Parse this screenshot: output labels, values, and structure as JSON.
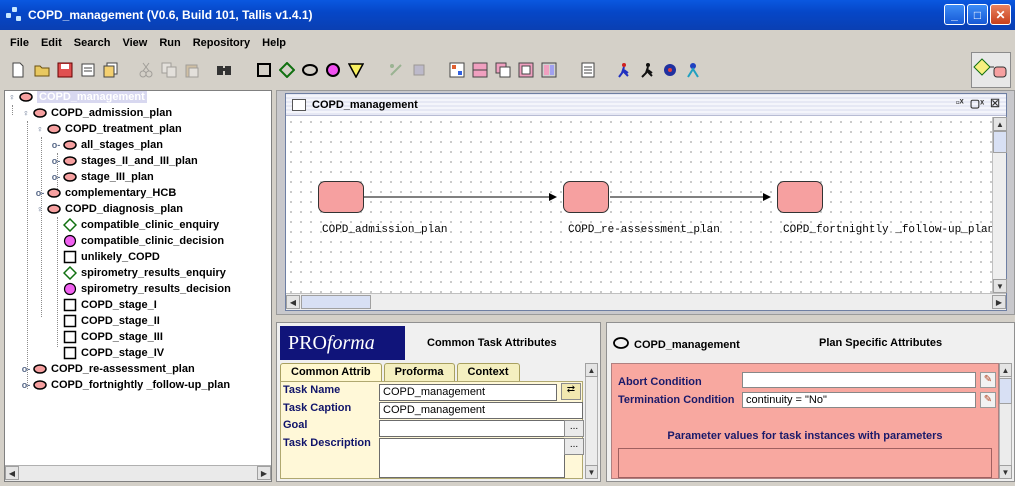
{
  "window": {
    "title": "COPD_management (V0.6, Build 101, Tallis v1.4.1)"
  },
  "menu": [
    "File",
    "Edit",
    "Search",
    "View",
    "Run",
    "Repository",
    "Help"
  ],
  "toolbar": {
    "icons": [
      "new-file-icon",
      "open-folder-icon",
      "save-icon",
      "properties-icon",
      "copy-doc-icon",
      "cut-icon",
      "copy-icon",
      "paste-icon",
      "find-icon",
      "plan-square-icon",
      "enquiry-diamond-icon",
      "plan-ellipse-icon",
      "decision-circle-icon",
      "action-triangle-icon",
      "link-icon",
      "unlink-icon",
      "grid-icon",
      "tile-icon",
      "cascade-icon",
      "window-icon",
      "windows-icon",
      "document-icon",
      "run-icon",
      "run-step-icon",
      "debug-icon",
      "stop-icon"
    ]
  },
  "tree": {
    "root": "COPD_management",
    "items": [
      {
        "label": "COPD_admission_plan",
        "type": "plan"
      },
      {
        "label": "COPD_treatment_plan",
        "type": "plan"
      },
      {
        "label": "all_stages_plan",
        "type": "plan"
      },
      {
        "label": "stages_II_and_III_plan",
        "type": "plan"
      },
      {
        "label": "stage_III_plan",
        "type": "plan"
      },
      {
        "label": "complementary_HCB",
        "type": "plan"
      },
      {
        "label": "COPD_diagnosis_plan",
        "type": "plan"
      },
      {
        "label": "compatible_clinic_enquiry",
        "type": "enquiry"
      },
      {
        "label": "compatible_clinic_decision",
        "type": "decision"
      },
      {
        "label": "unlikely_COPD",
        "type": "action"
      },
      {
        "label": "spirometry_results_enquiry",
        "type": "enquiry"
      },
      {
        "label": "spirometry_results_decision",
        "type": "decision"
      },
      {
        "label": "COPD_stage_I",
        "type": "action"
      },
      {
        "label": "COPD_stage_II",
        "type": "action"
      },
      {
        "label": "COPD_stage_III",
        "type": "action"
      },
      {
        "label": "COPD_stage_IV",
        "type": "action"
      },
      {
        "label": "COPD_re-assessment_plan",
        "type": "plan"
      },
      {
        "label": "COPD_fortnightly _follow-up_plan",
        "type": "plan"
      }
    ]
  },
  "canvas": {
    "title": "COPD_management",
    "nodes": [
      {
        "label": "COPD_admission_plan"
      },
      {
        "label": "COPD_re-assessment_plan"
      },
      {
        "label": "COPD_fortnightly _follow-up_plan"
      }
    ],
    "colors": {
      "node_fill": "#f6a0a0"
    }
  },
  "props": {
    "logo_pro": "PRO",
    "logo_forma": "forma",
    "heading": "Common Task Attributes",
    "tabs": [
      "Common Attrib",
      "Proforma",
      "Context"
    ],
    "task_name_label": "Task Name",
    "task_name_value": "COPD_management",
    "task_caption_label": "Task Caption",
    "task_caption_value": "COPD_management",
    "goal_label": "Goal",
    "task_description_label": "Task Description",
    "dots": "..."
  },
  "plan_attrs": {
    "name": "COPD_management",
    "heading": "Plan Specific Attributes",
    "abort_label": "Abort Condition",
    "abort_value": "",
    "termination_label": "Termination Condition",
    "termination_value": "continuity = \"No\"",
    "param_heading": "Parameter values for task instances with parameters",
    "colors": {
      "body": "#f8a8a0"
    }
  }
}
